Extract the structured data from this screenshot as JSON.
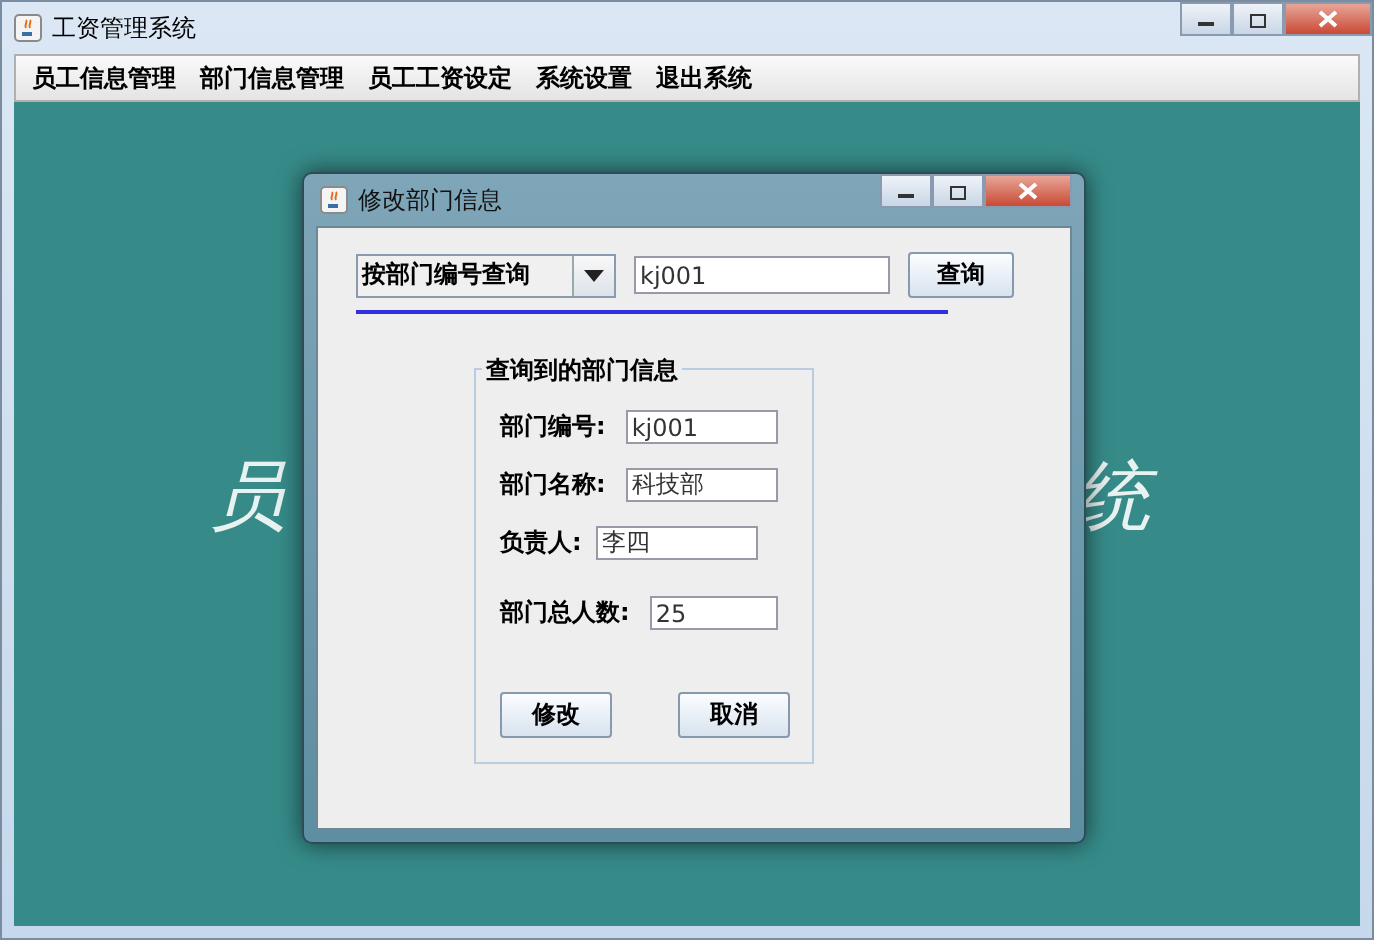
{
  "window": {
    "title": "工资管理系统"
  },
  "menu": [
    {
      "label": "员工信息管理"
    },
    {
      "label": "部门信息管理"
    },
    {
      "label": "员工工资设定"
    },
    {
      "label": "系统设置"
    },
    {
      "label": "退出系统"
    }
  ],
  "background_text": [
    "员",
    "统"
  ],
  "dialog": {
    "title": "修改部门信息",
    "search": {
      "mode": "按部门编号查询",
      "value": "kj001",
      "button": "查询"
    },
    "group": {
      "title": "查询到的部门信息",
      "fields": [
        {
          "label": "部门编号:",
          "value": "kj001"
        },
        {
          "label": "部门名称:",
          "value": "科技部"
        },
        {
          "label": "负责人:",
          "value": "李四"
        },
        {
          "label": "部门总人数:",
          "value": "25"
        }
      ]
    },
    "buttons": [
      "修改",
      "取消"
    ]
  }
}
